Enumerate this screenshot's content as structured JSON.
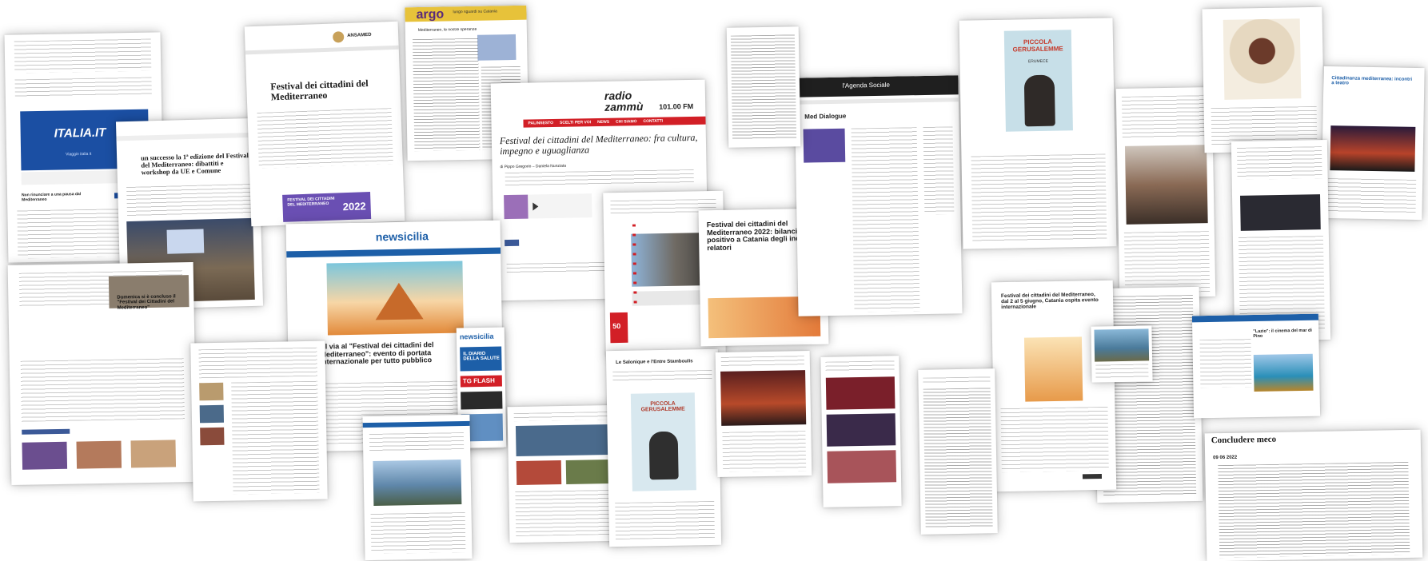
{
  "cards": {
    "italia": {
      "logo": "ITALIA.IT",
      "sub": "Viaggio italia it",
      "lead": "Non rinunciare a una pausa dal Mediterraneo"
    },
    "ansamed": {
      "brand": "ANSAMED",
      "headline": "Festival dei cittadini del Mediterraneo",
      "poster_title": "FESTIVAL DEI CITTADINI DEL MEDITERRANEO",
      "poster_year": "2022"
    },
    "argo": {
      "logo": "argo",
      "tag": "lungo sguardi su Catania",
      "title": "Mediterraneo, le nostre speranze"
    },
    "radio": {
      "logo1": "radio",
      "logo2": "zammù",
      "freq": "101.00 FM",
      "nav": [
        "PALINSESTO",
        "SCELTI PER VOI",
        "NEWS",
        "CHI SIAMO",
        "CONTATTI"
      ],
      "headline": "Festival dei cittadini del Mediterraneo: fra cultura, impegno e uguaglianza",
      "byline": "di Pippo Gregorio – Daniela Nunziata"
    },
    "agenda": {
      "brand": "l'Agenda Sociale",
      "title": "Med Dialogue"
    },
    "book_top": {
      "title": "PICCOLA GERUSALEMME",
      "author": "ERUMECE"
    },
    "book_bottom": {
      "title": "PICCOLA GERUSALEMME"
    },
    "newsicilia": {
      "logo": "newsicilia",
      "headline": "Al via al \"Festival dei cittadini del Mediterraneo\": evento di portata internazionale per tutto pubblico"
    },
    "newsicilia_side": {
      "logo": "newsicilia",
      "label1": "IL DIARIO DELLA SALUTE",
      "label2": "TG FLASH"
    },
    "left_mid": {
      "headline": "un successo la 1ª edizione del Festival del Mediterraneo: dibattiti e workshop da UE e Comune"
    },
    "left_low": {
      "headline": "Domenica si è concluso il \"Festival dei Cittadini del Mediterraneo\""
    },
    "mid_right": {
      "headline": "Festival dei cittadini del Mediterraneo 2022: bilancio positivo a Catania degli incontri, relatori"
    },
    "thessaloniki": {
      "headline": "Le Salonique e l'Entre Stamboulis"
    },
    "catania_live": {
      "headline": "Festival dei cittadini del Mediterraneo, dal 2 al 5 giugno, Catania ospita evento internazionale"
    },
    "right_blue": {
      "headline": "Cittadinanza mediterranea: incontri a teatro"
    },
    "right_low": {
      "headline": "\"Lazio\": il cinema del mar di Pino"
    },
    "bottom_right": {
      "headline": "Concludere meco",
      "date": "09 06 2022"
    },
    "badge": {
      "value": "50"
    }
  },
  "colors": {
    "italia_blue": "#1b4fa3",
    "radio_red": "#d21f26",
    "newsicilia_blue": "#1d5fa8",
    "ansamed_poster": "#6a4fb3",
    "argo_yellow": "#e7c23a",
    "dark": "#1f1f1f"
  }
}
